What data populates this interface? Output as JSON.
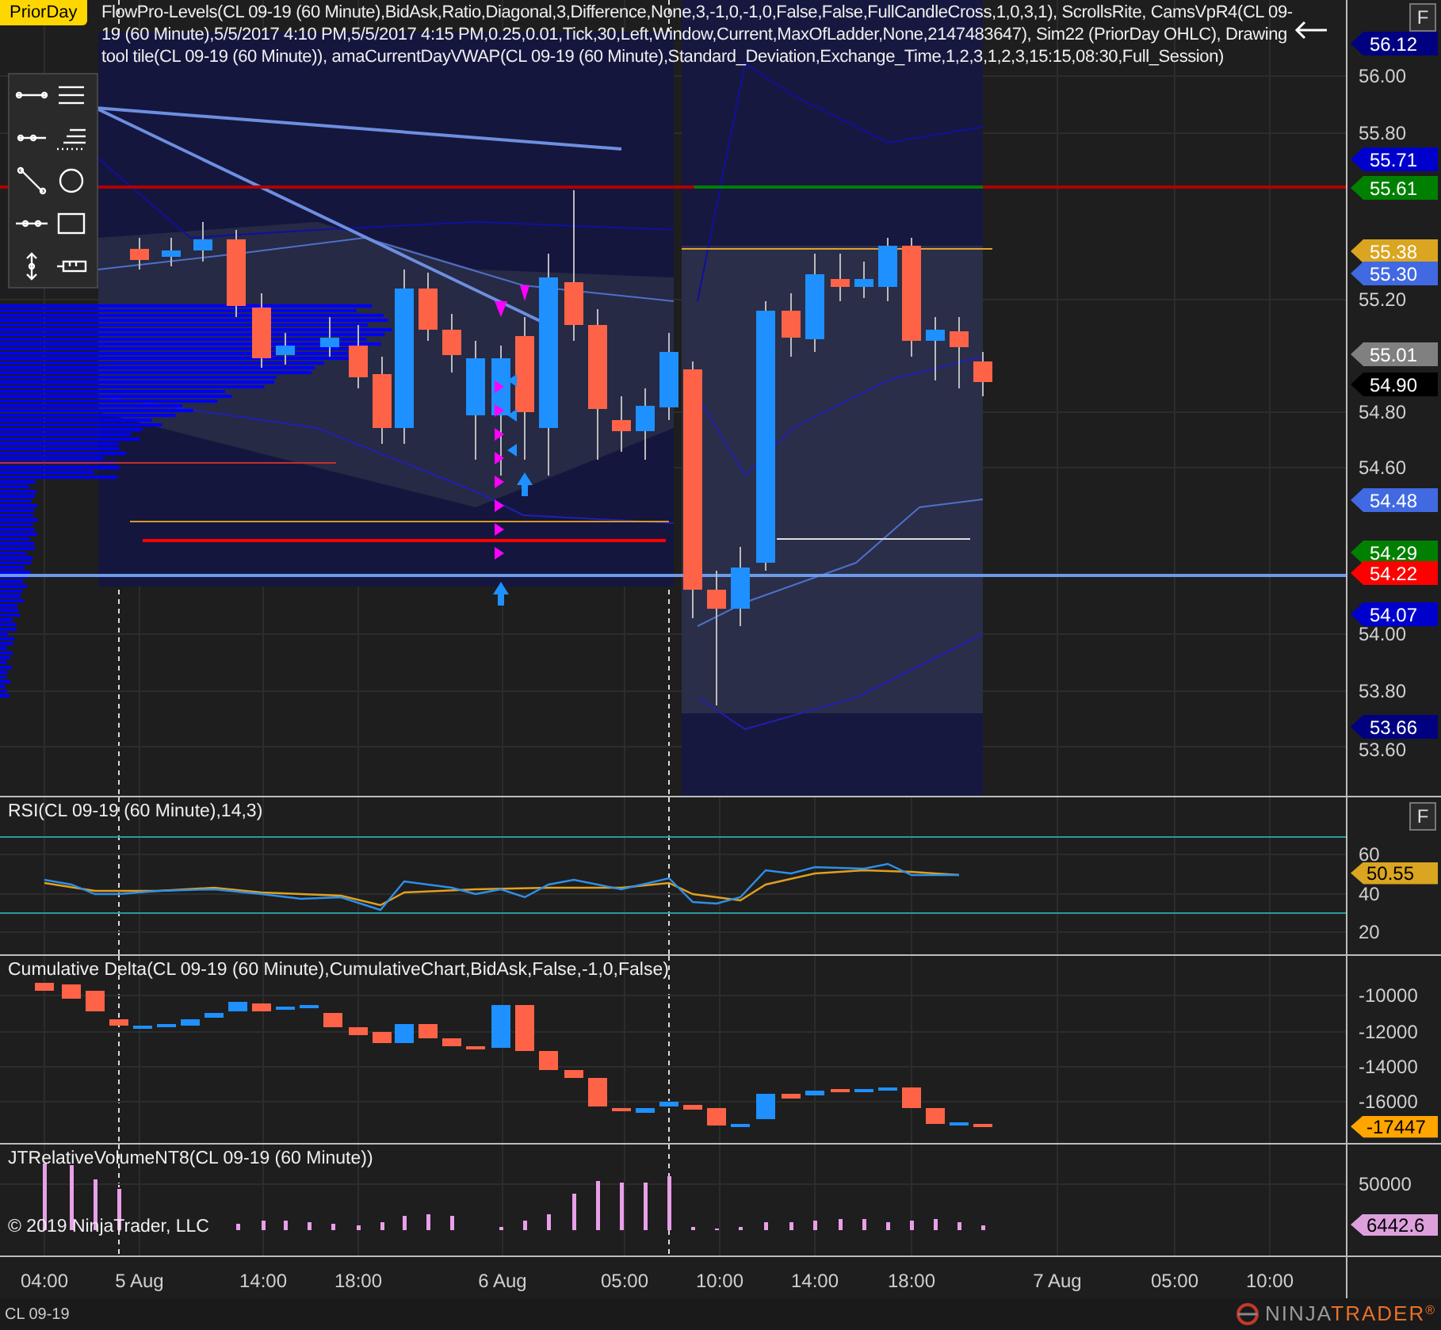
{
  "price_panel": {
    "badge": "PriorDay",
    "indicators": "FlowPro-Levels(CL 09-19 (60 Minute),BidAsk,Ratio,Diagonal,3,Difference,None,3,-1,0,-1,0,False,False,FullCandleCross,1,0,3,1), ScrollsRite, CamsVpR4(CL 09-19 (60 Minute),5/5/2017 4:10 PM,5/5/2017 4:15 PM,0.25,0.01,Tick,30,Left,Window,Current,MaxOfLadder,None,2147483647), Sim22 (PriorDay OHLC), Drawing tool tile(CL 09-19 (60 Minute)), amaCurrentDayVWAP(CL 09-19 (60 Minute),Standard_Deviation,Exchange_Time,1,2,3,1,2,3,15:15,08:30,Full_Session)",
    "format_button": "F",
    "ticks": [
      "56.00",
      "55.80",
      "55.20",
      "54.80",
      "54.60",
      "54.00",
      "53.80",
      "53.60"
    ],
    "markers": [
      {
        "value": "56.12",
        "color": "#000080"
      },
      {
        "value": "55.71",
        "color": "#0000cd"
      },
      {
        "value": "55.61",
        "color": "#008000"
      },
      {
        "value": "55.38",
        "color": "#daa520"
      },
      {
        "value": "55.30",
        "color": "#4169e1"
      },
      {
        "value": "55.01",
        "color": "#808080"
      },
      {
        "value": "54.90",
        "color": "#000000"
      },
      {
        "value": "54.48",
        "color": "#4169e1"
      },
      {
        "value": "54.29",
        "color": "#008000"
      },
      {
        "value": "54.22",
        "color": "#ff0000"
      },
      {
        "value": "54.07",
        "color": "#0000cd"
      },
      {
        "value": "53.66",
        "color": "#000080"
      }
    ]
  },
  "sub_panels": [
    {
      "kind": "rsi",
      "label": "RSI(CL 09-19 (60 Minute),14,3)",
      "format_button": "F",
      "ticks": [
        "60",
        "40",
        "20"
      ],
      "marker": {
        "value": "50.55",
        "color": "#daa520"
      }
    },
    {
      "kind": "delta",
      "label": "Cumulative Delta(CL 09-19 (60 Minute),CumulativeChart,BidAsk,False,-1,0,False)",
      "ticks": [
        "-10000",
        "-12000",
        "-14000",
        "-16000"
      ],
      "marker": {
        "value": "-17447",
        "color": "#ffa500"
      }
    },
    {
      "kind": "volume",
      "label": "JTRelativeVolumeNT8(CL 09-19 (60 Minute))",
      "copyright": "© 2019 NinjaTrader, LLC",
      "ticks": [
        "50000"
      ],
      "marker": {
        "value": "6442.6",
        "color": "#dda0dd"
      }
    }
  ],
  "time_axis": [
    "04:00",
    "5 Aug",
    "14:00",
    "18:00",
    "6 Aug",
    "05:00",
    "10:00",
    "14:00",
    "18:00",
    "7 Aug",
    "05:00",
    "10:00"
  ],
  "status_bar": {
    "instrument": "CL 09-19",
    "logo": [
      "NINJA",
      "TRADER",
      "®"
    ]
  }
}
